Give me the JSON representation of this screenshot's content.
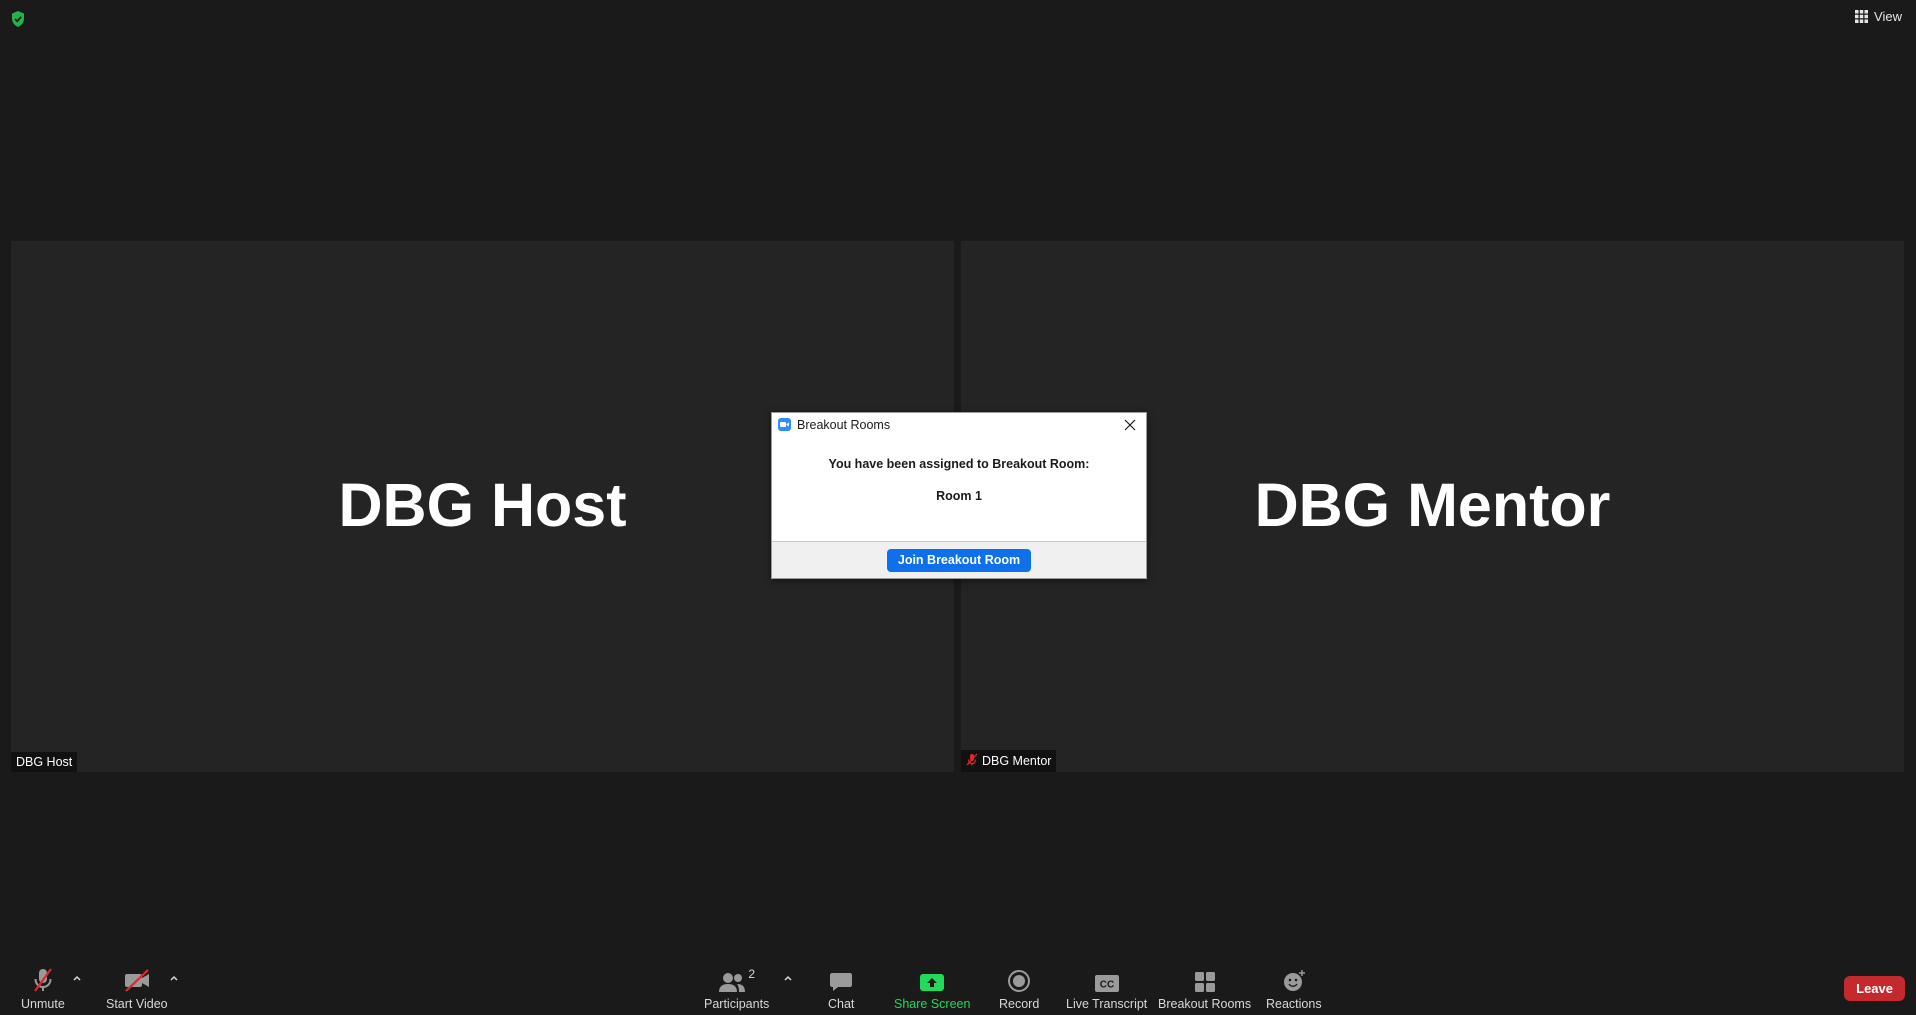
{
  "top": {
    "view_label": "View"
  },
  "tiles": [
    {
      "big_name": "DBG Host",
      "name_tag": "DBG Host",
      "muted": false
    },
    {
      "big_name": "DBG Mentor",
      "name_tag": "DBG Mentor",
      "muted": true
    }
  ],
  "modal": {
    "title": "Breakout Rooms",
    "message": "You have been assigned to Breakout Room:",
    "room": "Room 1",
    "join_label": "Join Breakout Room"
  },
  "toolbar": {
    "unmute_label": "Unmute",
    "start_video_label": "Start Video",
    "participants_label": "Participants",
    "participants_count": "2",
    "chat_label": "Chat",
    "share_screen_label": "Share Screen",
    "record_label": "Record",
    "live_transcript_label": "Live Transcript",
    "cc_text": "CC",
    "breakout_rooms_label": "Breakout Rooms",
    "reactions_label": "Reactions",
    "leave_label": "Leave"
  },
  "colors": {
    "background": "#1a1a1a",
    "tile": "#242424",
    "accent_blue": "#0e71eb",
    "share_green": "#23d959",
    "leave_red": "#c4292d",
    "muted_red": "#e02828"
  }
}
